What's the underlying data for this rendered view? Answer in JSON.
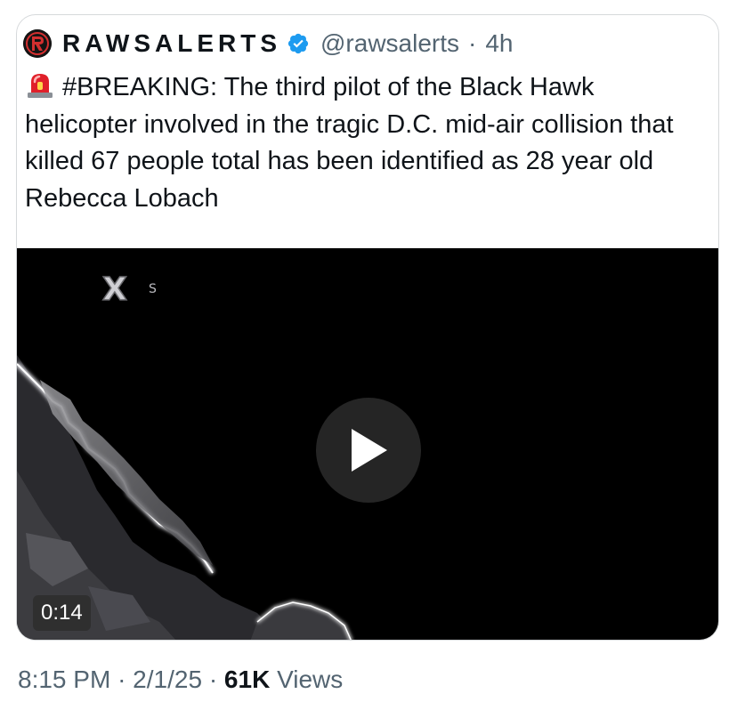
{
  "tweet": {
    "display_name": "RAWSALERTS",
    "handle": "@rawsalerts",
    "separator": "·",
    "age": "4h",
    "text": "#BREAKING: The third pilot of the Black Hawk helicopter involved in the tragic D.C. mid-air collision that killed 67 people total has been identified as 28 year old Rebecca Lobach",
    "emoji_icon": "police-car-light-icon"
  },
  "media": {
    "type": "video",
    "duration": "0:14",
    "watermark": "X",
    "watermark_small": "S"
  },
  "meta": {
    "time": "8:15 PM",
    "date": "2/1/25",
    "views_count": "61K",
    "views_label": "Views",
    "separator": "·"
  },
  "colors": {
    "verified": "#1d9bf0",
    "muted": "#536471",
    "text": "#0f1419",
    "siren_red": "#e0202a"
  }
}
